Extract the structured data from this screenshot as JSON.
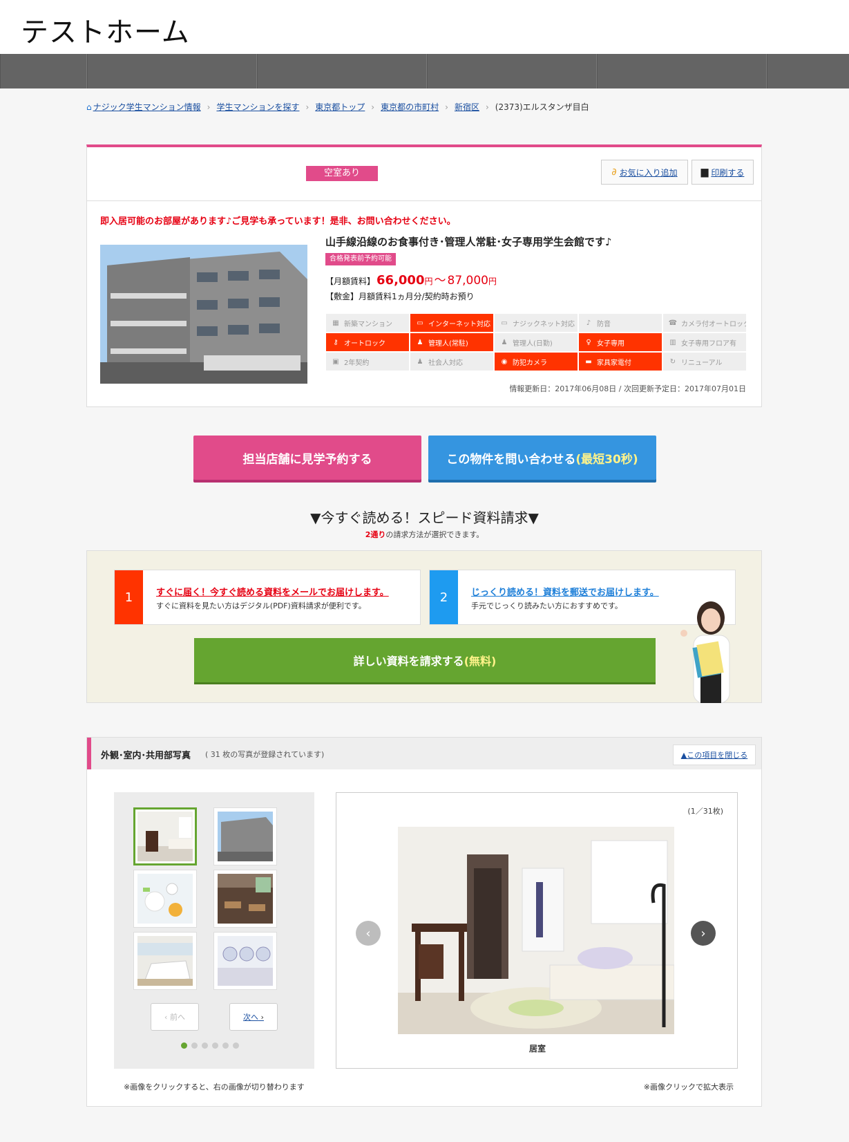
{
  "site": {
    "title": "テストホーム"
  },
  "breadcrumb": [
    {
      "label": "ナジック学生マンション情報",
      "link": true
    },
    {
      "label": "学生マンションを探す",
      "link": true
    },
    {
      "label": "東京都トップ",
      "link": true
    },
    {
      "label": "東京都の市町村",
      "link": true
    },
    {
      "label": "新宿区",
      "link": true
    },
    {
      "label": "(2373)エルスタンザ目白",
      "link": false
    }
  ],
  "property": {
    "vacancy_badge": "空室あり",
    "favorite_label": "お気に入り追加",
    "print_label": "印刷する",
    "notice": "即入居可能のお部屋があります♪ご見学も承っています！是非、お問い合わせください。",
    "title": "山手線沿線のお食事付き･管理人常駐･女子専用学生会館です♪",
    "tag": "合格発表前予約可能",
    "rent_label": "【月額賃料】",
    "rent_min": "66,000",
    "rent_unit": "円",
    "rent_sep": "～",
    "rent_max": "87,000",
    "deposit": "【敷金】月額賃料1ヵ月分/契約時お預り",
    "updated": "情報更新日：2017年06月08日 / 次回更新予定日：2017年07月01日",
    "features": [
      {
        "label": "新築マンション",
        "on": false,
        "icon": "building-icon"
      },
      {
        "label": "インターネット対応",
        "on": true,
        "icon": "monitor-icon"
      },
      {
        "label": "ナジックネット対応",
        "on": false,
        "icon": "monitor-icon"
      },
      {
        "label": "防音",
        "on": false,
        "icon": "music-icon"
      },
      {
        "label": "カメラ付オートロック",
        "on": false,
        "icon": "intercom-icon"
      },
      {
        "label": "オートロック",
        "on": true,
        "icon": "key-icon"
      },
      {
        "label": "管理人(常駐)",
        "on": true,
        "icon": "person-icon"
      },
      {
        "label": "管理人(日勤)",
        "on": false,
        "icon": "person-icon"
      },
      {
        "label": "女子専用",
        "on": true,
        "icon": "female-icon"
      },
      {
        "label": "女子専用フロア有",
        "on": false,
        "icon": "floor-icon"
      },
      {
        "label": "2年契約",
        "on": false,
        "icon": "calendar-icon"
      },
      {
        "label": "社会人対応",
        "on": false,
        "icon": "person-icon"
      },
      {
        "label": "防犯カメラ",
        "on": true,
        "icon": "camera-icon"
      },
      {
        "label": "家具家電付",
        "on": true,
        "icon": "furniture-icon"
      },
      {
        "label": "リニューアル",
        "on": false,
        "icon": "renew-icon"
      }
    ]
  },
  "cta": {
    "visit": "担当店舗に見学予約する",
    "inquiry": "この物件を問い合わせる",
    "inquiry_highlight": "(最短30秒)"
  },
  "speed_request": {
    "title": "▼今すぐ読める！スピード資料請求▼",
    "sub_highlight": "2通り",
    "sub_rest": "の請求方法が選択できます。",
    "options": [
      {
        "num": "1",
        "head": "すぐに届く！今すぐ読める資料をメールでお届けします。",
        "desc": "すぐに資料を見たい方はデジタル(PDF)資料請求が便利です。"
      },
      {
        "num": "2",
        "head": "じっくり読める！資料を郵送でお届けします。",
        "desc": "手元でじっくり読みたい方におすすめです。"
      }
    ],
    "button": "詳しい資料を請求する",
    "button_highlight": "(無料)"
  },
  "photos": {
    "title": "外観･室内･共用部写真",
    "count": "( 31 枚の写真が登録されています)",
    "close_label": "▲この項目を閉じる",
    "prev_label": "前へ",
    "next_label": "次へ",
    "counter": "(1／31枚)",
    "caption": "居室",
    "note_left": "※画像をクリックすると、右の画像が切り替わります",
    "note_right": "※画像クリックで拡大表示",
    "page_dots": 6,
    "active_dot": 1
  },
  "colors": {
    "pink": "#e14b8a",
    "blue": "#3595e0",
    "green": "#65a530",
    "red": "#ff3300",
    "nav": "#646464"
  }
}
